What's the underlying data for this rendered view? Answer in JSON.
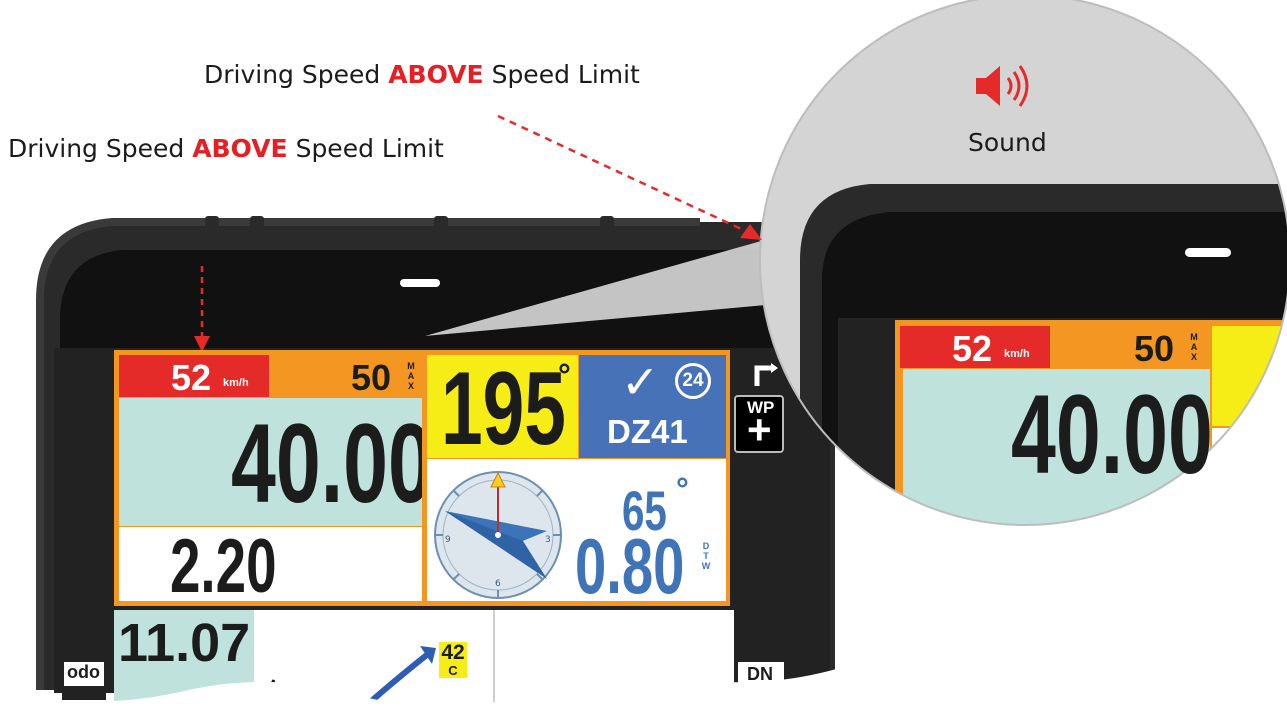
{
  "captions": {
    "top": {
      "prefix": "Driving Speed ",
      "highlight": "ABOVE",
      "suffix": " Speed Limit"
    },
    "left": {
      "prefix": "Driving Speed ",
      "highlight": "ABOVE",
      "suffix": " Speed Limit"
    }
  },
  "sound": {
    "label": "Sound",
    "icon": "speaker-volume-icon"
  },
  "speed": {
    "current": "52",
    "unit": "km/h",
    "limit": "50",
    "limit_tag": [
      "M",
      "A",
      "X"
    ]
  },
  "odometer": {
    "main": "40.00",
    "partial": "2.20"
  },
  "heading": {
    "value": "195",
    "degree": "°"
  },
  "waypoint": {
    "count": "24",
    "name": "DZ41",
    "check": "✓"
  },
  "compass": {
    "labels": [
      "3",
      "6",
      "9"
    ]
  },
  "bearing": {
    "angle": "65",
    "degree": "°",
    "distance": "0.80",
    "dtw_tag": [
      "D",
      "T",
      "W"
    ]
  },
  "side_buttons": {
    "wp": "WP",
    "dn": "DN",
    "odo": "odo"
  },
  "bottom": {
    "value": "11.07",
    "note_value": "42",
    "note_letter": "C"
  },
  "colors": {
    "red": "#e52a2a",
    "orange": "#f39722",
    "mint": "#bfe2dc",
    "yellow": "#f6ec16",
    "blue": "#4872b8",
    "dtw_blue": "#3f74b8",
    "device": "#2d2d2d"
  }
}
